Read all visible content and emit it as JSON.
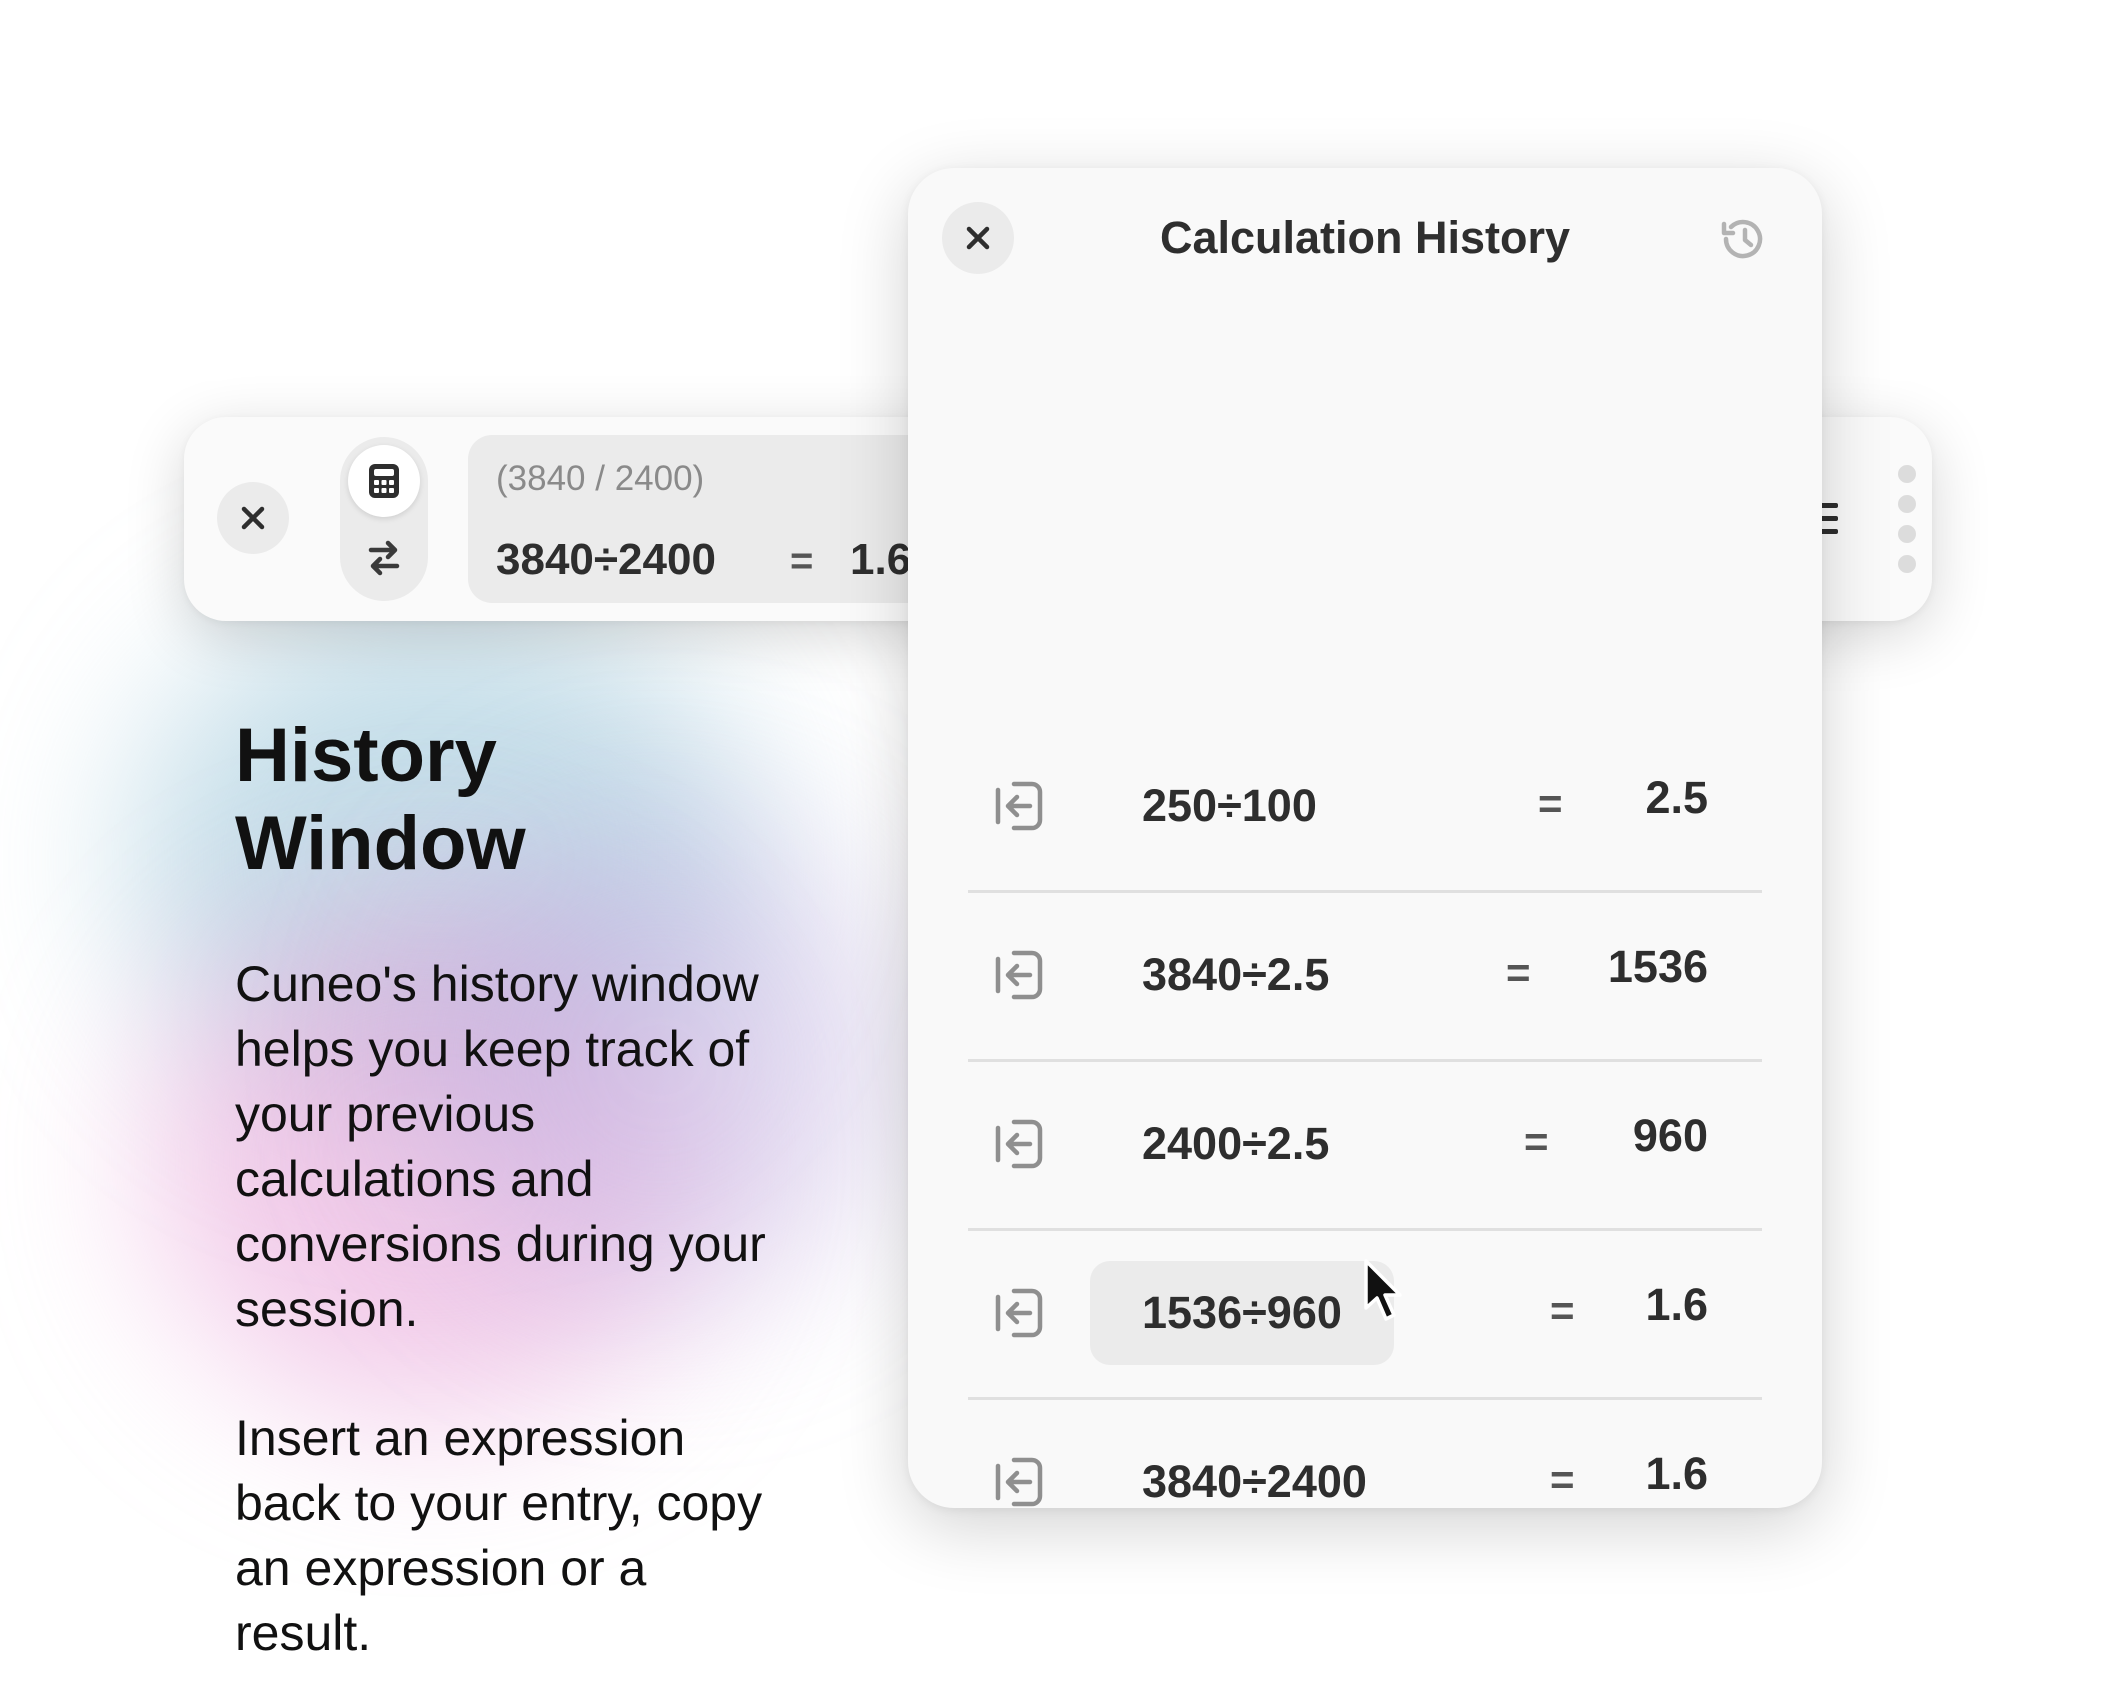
{
  "calculator_bar": {
    "close_icon": "close-icon",
    "mode_calculator_icon": "calculator-icon",
    "mode_convert_icon": "swap-arrows-icon",
    "entry_raw": "(3840 / 2400)",
    "entry_expression": "3840÷2400",
    "entry_equals": "=",
    "entry_result": "1.6",
    "menu_icon": "list-icon",
    "drag_handle_icon": "vertical-dots-icon"
  },
  "intro": {
    "headline_line1": "History",
    "headline_line2": "Window",
    "paragraph1": "Cuneo's history window helps you keep track of your previous calculations and conversions during your session.",
    "paragraph2": "Insert an expression back to your entry, copy an expression or a result."
  },
  "history_panel": {
    "title": "Calculation History",
    "close_icon": "close-icon",
    "history_icon": "history-clock-icon",
    "insert_icon": "insert-into-entry-icon",
    "rows": [
      {
        "expression": "250÷100",
        "equals": "=",
        "result": "2.5",
        "hovered": false
      },
      {
        "expression": "3840÷2.5",
        "equals": "=",
        "result": "1536",
        "hovered": false
      },
      {
        "expression": "2400÷2.5",
        "equals": "=",
        "result": "960",
        "hovered": false
      },
      {
        "expression": "1536÷960",
        "equals": "=",
        "result": "1.6",
        "hovered": true
      },
      {
        "expression": "3840÷2400",
        "equals": "=",
        "result": "1.6",
        "hovered": false
      }
    ]
  },
  "cursor_icon": "mouse-pointer-icon",
  "colors": {
    "panel_background": "#f9f9f9",
    "pill_background": "#ebebeb",
    "text_primary": "#2e2e2e",
    "text_secondary": "#8a8a8a",
    "divider": "#e0e0e0"
  }
}
